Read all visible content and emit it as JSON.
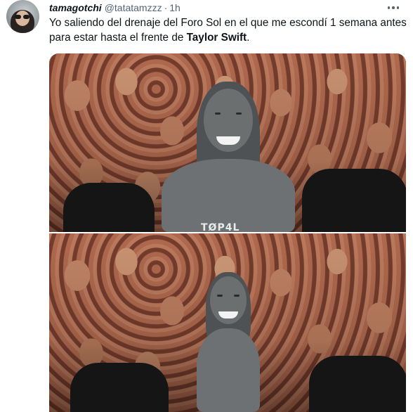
{
  "tweet": {
    "author_name": "tamagotchi",
    "handle": "@tatatamzzz",
    "separator": "·",
    "time": "1h",
    "text_before": "Yo saliendo del drenaje del Foro Sol en el que me escondí 1 semana antes para estar hasta el frente de ",
    "text_bold": "Taylor Swift",
    "text_after": ".",
    "more_icon": "ellipsis-icon",
    "avatar_icon": "avatar"
  },
  "media": {
    "watermark": "TØP4L"
  },
  "colors": {
    "text_primary": "#0f1419",
    "text_secondary": "#536471",
    "background": "#ffffff"
  }
}
